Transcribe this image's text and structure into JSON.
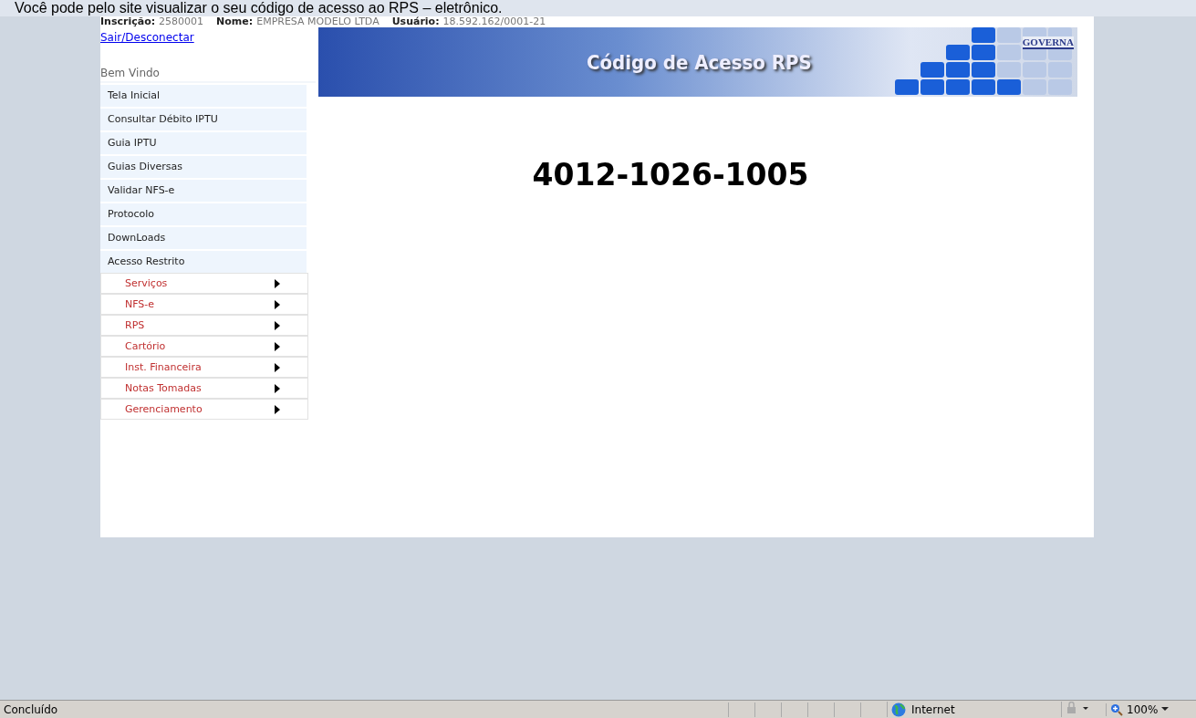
{
  "caption": "Você pode pelo site visualizar o seu código de acesso ao RPS – eletrônico.",
  "header": {
    "fields": [
      {
        "label": "Inscrição:",
        "value": "2580001"
      },
      {
        "label": "Nome:",
        "value": "EMPRESA MODELO LTDA"
      },
      {
        "label": "Usuário:",
        "value": "18.592.162/0001-21"
      }
    ],
    "logout": "Sair/Desconectar"
  },
  "welcome": "Bem Vindo",
  "menu": [
    {
      "label": "Tela Inicial"
    },
    {
      "label": "Consultar Débito IPTU"
    },
    {
      "label": "Guia IPTU"
    },
    {
      "label": "Guias Diversas"
    },
    {
      "label": "Validar NFS-e"
    },
    {
      "label": "Protocolo"
    },
    {
      "label": "DownLoads"
    },
    {
      "label": "Acesso Restrito",
      "children": [
        {
          "label": "Serviços"
        },
        {
          "label": "NFS-e"
        },
        {
          "label": "RPS"
        },
        {
          "label": "Cartório"
        },
        {
          "label": "Inst. Financeira"
        },
        {
          "label": "Notas Tomadas"
        },
        {
          "label": "Gerenciamento"
        }
      ]
    }
  ],
  "banner": {
    "title": "Código de Acesso RPS",
    "logo": "GOVERNA"
  },
  "access_code": "4012-1026-1005",
  "status_bar": {
    "status": "Concluído",
    "zone": "Internet",
    "zoom": "100%"
  }
}
